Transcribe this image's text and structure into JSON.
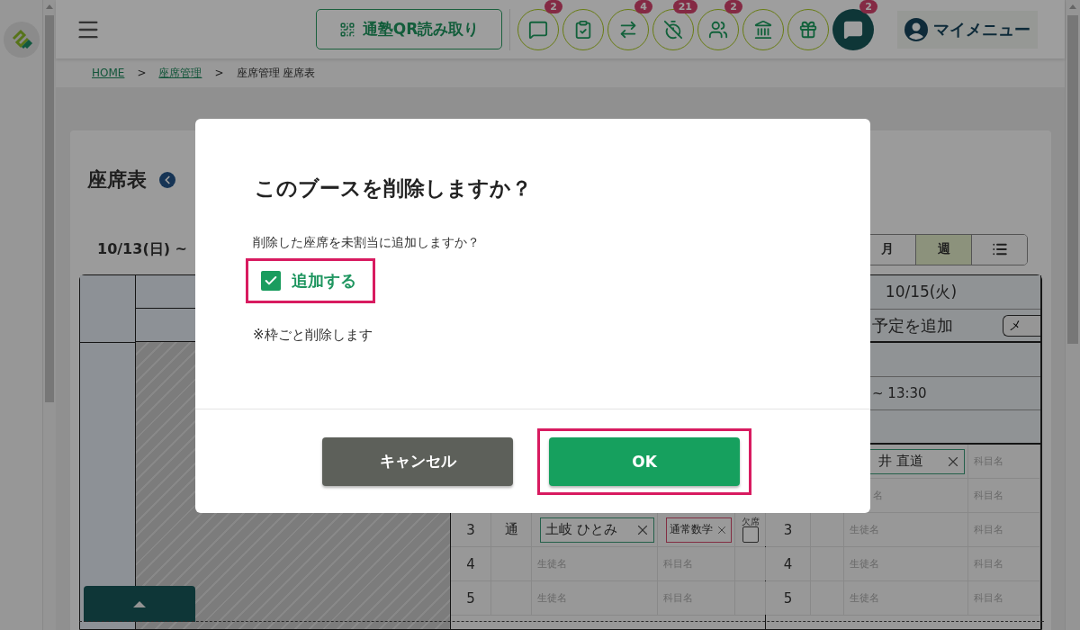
{
  "header": {
    "qr_button": "通塾QR読み取り",
    "icon_buttons": [
      {
        "kind": "chat",
        "badge": "2",
        "selected": false
      },
      {
        "kind": "checklist",
        "selected": false
      },
      {
        "kind": "arrows",
        "badge": "4",
        "selected": false
      },
      {
        "kind": "timer-off",
        "badge": "21",
        "selected": false
      },
      {
        "kind": "group",
        "badge": "2",
        "selected": false
      },
      {
        "kind": "bank",
        "selected": false
      },
      {
        "kind": "gift",
        "selected": false
      },
      {
        "kind": "chat",
        "badge": "2",
        "selected": true
      }
    ],
    "my_menu": "マイメニュー"
  },
  "breadcrumb": [
    {
      "kind": "link",
      "label": "HOME"
    },
    {
      "kind": "sep",
      "label": ">"
    },
    {
      "kind": "link",
      "label": "座席管理"
    },
    {
      "kind": "sep",
      "label": ">"
    },
    {
      "kind": "current",
      "label": "座席管理 座席表"
    }
  ],
  "page_title": "座席表",
  "date_range": "10/13(日) ~",
  "view_toggle": [
    {
      "kind": "text",
      "label": "月",
      "selected": false
    },
    {
      "kind": "text",
      "label": "週",
      "selected": true
    },
    {
      "kind": "list",
      "selected": false
    }
  ],
  "day1_rows": [
    {
      "no": "3",
      "type": "通",
      "student": "土岐 ひとみ",
      "subject": "通常数学",
      "absent_label": "欠席",
      "absent": false
    },
    {
      "no": "4",
      "student_placeholder": "生徒名",
      "subject_placeholder": "科目名"
    },
    {
      "no": "5",
      "student_placeholder": "生徒名",
      "subject_placeholder": "科目名"
    }
  ],
  "day2": {
    "date": "10/15(火)",
    "add_label": "予定を追加",
    "memo_button": "メ",
    "time": "~ 13:30",
    "rows": [
      {
        "student": "井 直道",
        "subject_placeholder": "科目名"
      },
      {
        "student_placeholder": "名",
        "subject_placeholder": "科目名"
      },
      {
        "no": "3",
        "student_placeholder": "生徒名",
        "subject_placeholder": "科目名"
      },
      {
        "no": "4",
        "student_placeholder": "生徒名",
        "subject_placeholder": "科目名"
      },
      {
        "no": "5",
        "student_placeholder": "生徒名",
        "subject_placeholder": "科目名"
      }
    ]
  },
  "modal": {
    "title": "このブースを削除しますか？",
    "question": "削除した座席を未割当に追加しますか？",
    "checkbox": {
      "label": "追加する",
      "checked": true,
      "highlighted": true
    },
    "note": "※枠ごと削除します",
    "cancel_button": "キャンセル",
    "ok_button": {
      "label": "OK",
      "highlighted": true
    }
  }
}
